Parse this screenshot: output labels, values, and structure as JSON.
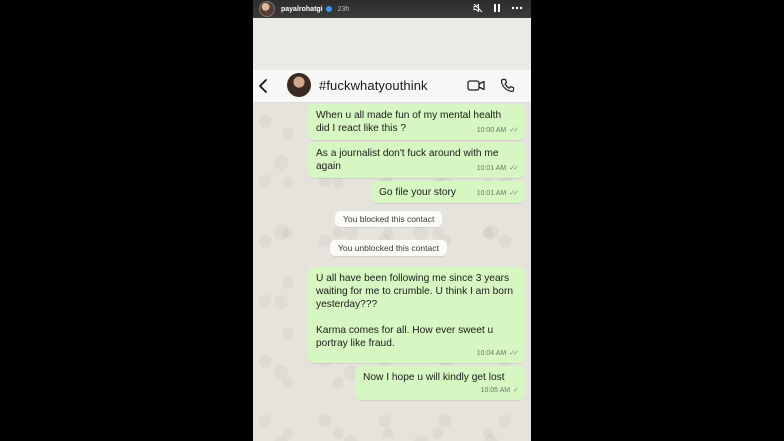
{
  "story": {
    "username": "payalrohatgi",
    "time_ago": "23h"
  },
  "chat": {
    "title": "#fuckwhatyouthink"
  },
  "messages": [
    {
      "text": "When u all made fun of my mental health did I react like this ?",
      "time": "10:00 AM",
      "ticks": "✓✓"
    },
    {
      "text": "As a journalist don't fuck around with me again",
      "time": "10:01 AM",
      "ticks": "✓✓"
    },
    {
      "text": "Go file your story",
      "time": "10:01 AM",
      "ticks": "✓✓"
    },
    {
      "text": "U all have been following me since 3 years waiting for me to crumble. U think I am born yesterday???\n\nKarma comes for all. How ever sweet u portray like fraud.",
      "time": "10:04 AM",
      "ticks": "✓✓"
    },
    {
      "text": "Now I hope u will kindly get lost",
      "time": "10:05 AM",
      "ticks": "✓"
    }
  ],
  "system": [
    {
      "text": "You blocked this contact"
    },
    {
      "text": "You unblocked this contact"
    }
  ],
  "icons": [
    "back-arrow-icon",
    "video-call-icon",
    "phone-call-icon",
    "mute-icon",
    "pause-icon",
    "more-icon"
  ],
  "colors": {
    "bubble": "#d6f7c2",
    "chat_bg": "#e6e3dc"
  }
}
